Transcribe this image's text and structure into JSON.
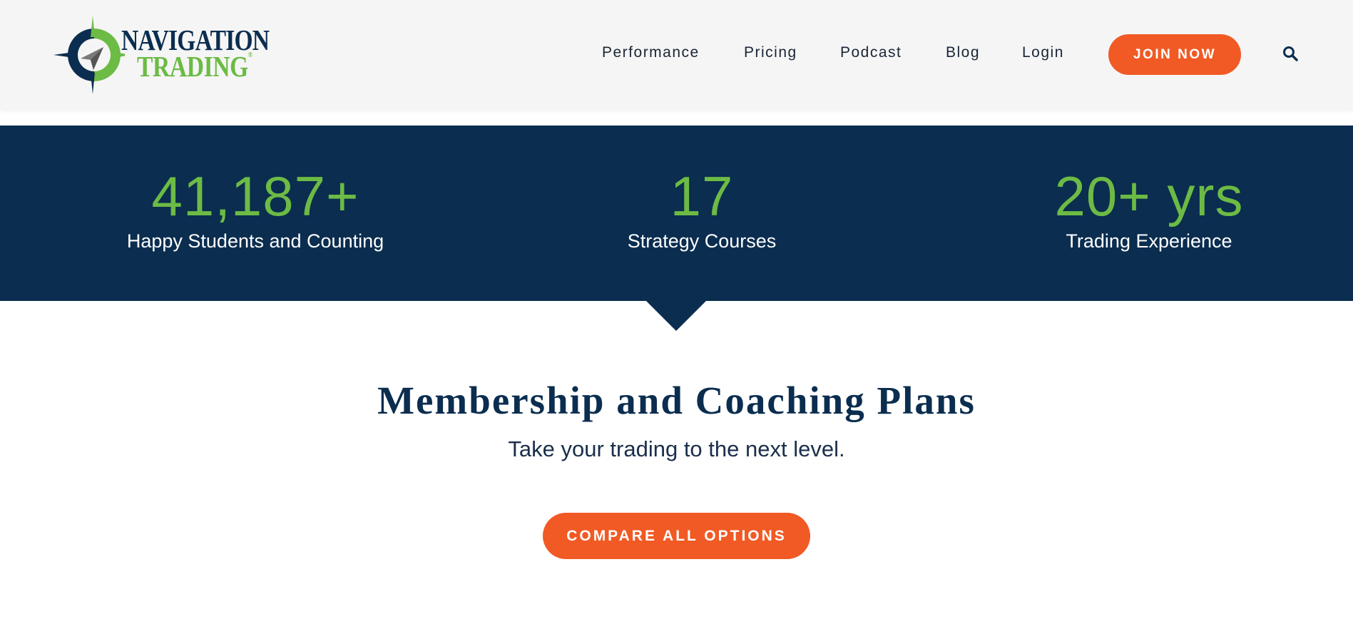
{
  "brand": {
    "logo_line1": "NAVIGATION",
    "logo_line2": "TRADING",
    "registered_mark": "®",
    "primary_color": "#0b2d4f",
    "accent_green": "#6cbb45",
    "accent_orange": "#f15a24"
  },
  "nav": {
    "items": [
      {
        "label": "Performance"
      },
      {
        "label": "Pricing"
      },
      {
        "label": "Podcast"
      },
      {
        "label": "Blog"
      },
      {
        "label": "Login"
      }
    ],
    "cta_label": "JOIN NOW",
    "search_icon": "search-icon"
  },
  "stats": [
    {
      "value": "41,187+",
      "label": "Happy Students and Counting"
    },
    {
      "value": "17",
      "label": "Strategy Courses"
    },
    {
      "value": "20+ yrs",
      "label": "Trading Experience"
    }
  ],
  "plans": {
    "title": "Membership and Coaching Plans",
    "subtitle": "Take your trading to the next level.",
    "button_label": "COMPARE ALL OPTIONS"
  }
}
